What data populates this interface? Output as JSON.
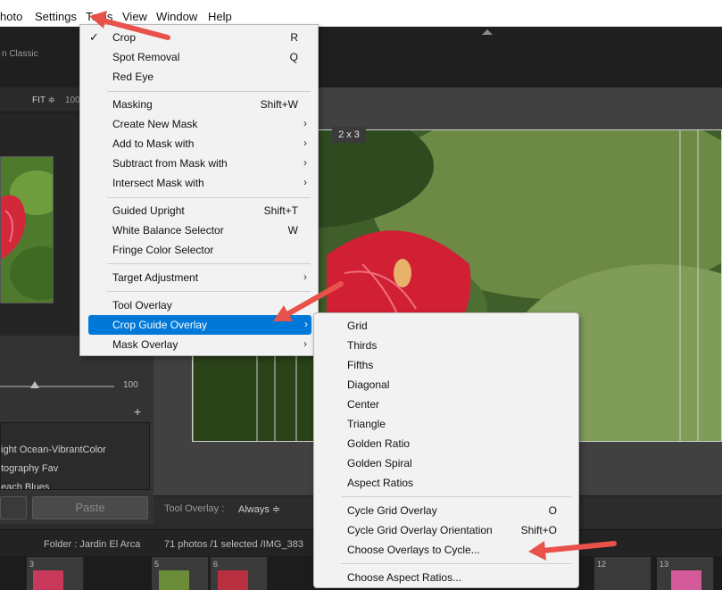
{
  "menubar": {
    "items": [
      "hoto",
      "Settings",
      "Tools",
      "View",
      "Window",
      "Help"
    ]
  },
  "brand": {
    "text": "n Classic"
  },
  "navigator": {
    "fit_label": "FIT ≑",
    "zoom_partial": "100"
  },
  "slider": {
    "value": "100"
  },
  "presets": {
    "items": [
      "ight Ocean-VibrantColor",
      "tography Fav",
      "each Blues"
    ]
  },
  "paste_button": "Paste",
  "crop_overlay": {
    "label": "2 x 3"
  },
  "toolbar": {
    "tool_overlay_label": "Tool Overlay :",
    "tool_overlay_value": "Always ≑"
  },
  "filmstrip": {
    "folder": "Folder : Jardin El Arca",
    "count": "71 photos /1 selected /IMG_383",
    "numbers": [
      "3",
      "5",
      "6",
      "12",
      "13"
    ]
  },
  "tools_menu": {
    "items": [
      {
        "label": "Crop",
        "shortcut": "R",
        "checked": true
      },
      {
        "label": "Spot Removal",
        "shortcut": "Q"
      },
      {
        "label": "Red Eye",
        "shortcut": ""
      },
      {
        "label": "Masking",
        "shortcut": "Shift+W"
      },
      {
        "label": "Create New Mask",
        "submenu": true
      },
      {
        "label": "Add to Mask with",
        "submenu": true
      },
      {
        "label": "Subtract from Mask with",
        "submenu": true
      },
      {
        "label": "Intersect Mask with",
        "submenu": true
      },
      {
        "label": "Guided Upright",
        "shortcut": "Shift+T"
      },
      {
        "label": "White Balance Selector",
        "shortcut": "W"
      },
      {
        "label": "Fringe Color Selector",
        "shortcut": ""
      },
      {
        "label": "Target Adjustment",
        "submenu": true
      },
      {
        "label": "Tool Overlay",
        "shortcut": ""
      },
      {
        "label": "Crop Guide Overlay",
        "submenu": true,
        "highlighted": true
      },
      {
        "label": "Mask Overlay",
        "submenu": true
      }
    ],
    "submenu_arrow": "›",
    "check_mark": "✓"
  },
  "crop_guide_submenu": {
    "items": [
      {
        "label": "Grid"
      },
      {
        "label": "Thirds"
      },
      {
        "label": "Fifths"
      },
      {
        "label": "Diagonal"
      },
      {
        "label": "Center"
      },
      {
        "label": "Triangle"
      },
      {
        "label": "Golden Ratio"
      },
      {
        "label": "Golden Spiral"
      },
      {
        "label": "Aspect Ratios"
      },
      {
        "label": "Cycle Grid Overlay",
        "shortcut": "O"
      },
      {
        "label": "Cycle Grid Overlay Orientation",
        "shortcut": "Shift+O"
      },
      {
        "label": "Choose Overlays to Cycle..."
      },
      {
        "label": "Choose Aspect Ratios..."
      }
    ]
  },
  "colors": {
    "highlight": "#0078d7",
    "annotation_arrow": "#e8524a",
    "menu_bg": "#f2f2f2",
    "app_bg": "#2b2b2b"
  },
  "icons": [
    "check-icon",
    "chevron-right-icon",
    "plus-icon",
    "arrow-annotation-icon"
  ]
}
